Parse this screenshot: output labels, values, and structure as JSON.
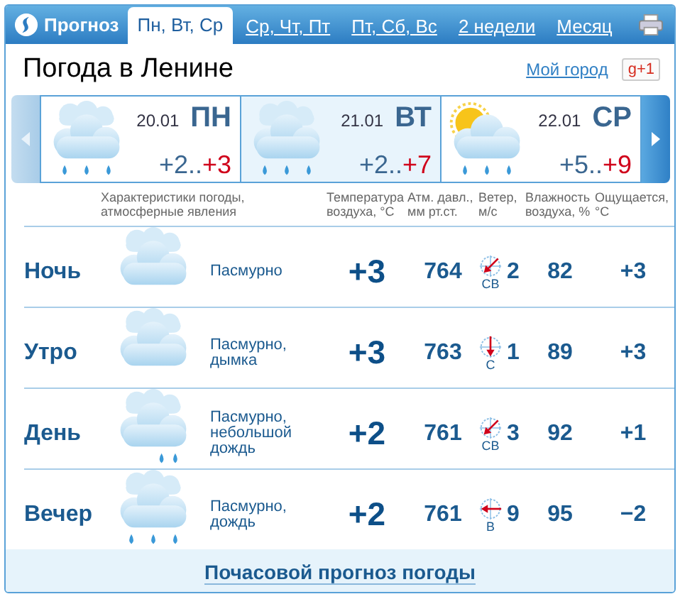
{
  "header": {
    "logo": "Прогноз",
    "tabs": [
      {
        "label": "Пн, Вт, Ср",
        "selected": true
      },
      {
        "label": "Ср, Чт, Пт",
        "selected": false
      },
      {
        "label": "Пт, Сб, Вс",
        "selected": false
      },
      {
        "label": "2 недели",
        "selected": false
      },
      {
        "label": "Месяц",
        "selected": false
      }
    ]
  },
  "title": "Погода в Ленине",
  "my_city": "Мой город",
  "plus_one": "g+1",
  "days": {
    "prev": {
      "disabled": true
    },
    "next": {
      "disabled": false
    },
    "cards": [
      {
        "date": "20.01",
        "weekday": "ПН",
        "temp_low": "+2..",
        "temp_high": "+3",
        "kind": "cloud-rain",
        "selected": false
      },
      {
        "date": "21.01",
        "weekday": "ВТ",
        "temp_low": "+2..",
        "temp_high": "+7",
        "kind": "cloud-rain",
        "selected": true
      },
      {
        "date": "22.01",
        "weekday": "СР",
        "temp_low": "+5..",
        "temp_high": "+9",
        "kind": "sun-cloud-rain",
        "selected": false
      }
    ]
  },
  "table": {
    "columns": [
      "Характеристики погоды,\nатмосферные явления",
      "Температура\nвоздуха, °C",
      "Атм. давл.,\nмм рт.ст.",
      "Ветер,\nм/с",
      "Влажность\nвоздуха, %",
      "Ощущается,\n°C"
    ],
    "rows": [
      {
        "period": "Ночь",
        "kind": "cloud",
        "description": "Пасмурно",
        "temperature": "+3",
        "pressure": "764",
        "wind": {
          "kind": "ne",
          "label": "СВ",
          "speed": "2"
        },
        "humidity": "82",
        "feels_like": "+3"
      },
      {
        "period": "Утро",
        "kind": "cloud",
        "description": "Пасмурно, дымка",
        "temperature": "+3",
        "pressure": "763",
        "wind": {
          "kind": "n",
          "label": "С",
          "speed": "1"
        },
        "humidity": "89",
        "feels_like": "+3"
      },
      {
        "period": "День",
        "kind": "cloud-light-rain",
        "description": "Пасмурно, небольшой дождь",
        "temperature": "+2",
        "pressure": "761",
        "wind": {
          "kind": "ne",
          "label": "СВ",
          "speed": "3"
        },
        "humidity": "92",
        "feels_like": "+1"
      },
      {
        "period": "Вечер",
        "kind": "cloud-rain",
        "description": "Пасмурно, дождь",
        "temperature": "+2",
        "pressure": "761",
        "wind": {
          "kind": "e",
          "label": "В",
          "speed": "9"
        },
        "humidity": "95",
        "feels_like": "−2"
      }
    ]
  },
  "footer_link": "Почасовой прогноз погоды"
}
